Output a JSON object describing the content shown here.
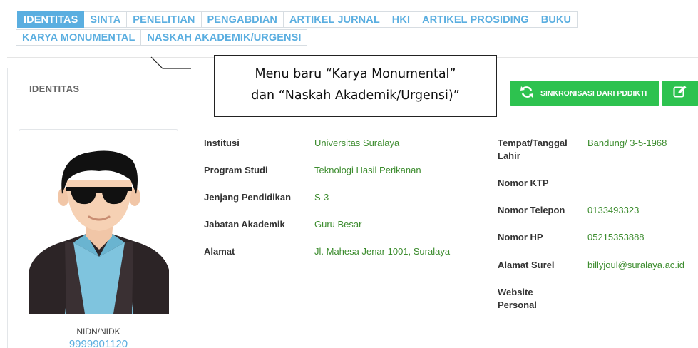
{
  "tabs": {
    "row1": [
      "IDENTITAS",
      "SINTA",
      "PENELITIAN",
      "PENGABDIAN",
      "ARTIKEL JURNAL",
      "HKI",
      "ARTIKEL PROSIDING",
      "BUKU"
    ],
    "row2": [
      "KARYA MONUMENTAL",
      "NASKAH AKADEMIK/URGENSI"
    ],
    "active": "IDENTITAS"
  },
  "panel": {
    "title": "IDENTITAS",
    "sync_label": "SINKRONISASI DARI PDDIKTI"
  },
  "callout": {
    "line1": "Menu baru “Karya Monumental”",
    "line2": "dan “Naskah Akademik/Urgensi)”"
  },
  "profile": {
    "nidn_label": "NIDN/NIDK",
    "nidn_value": "9999901120"
  },
  "left_fields": [
    {
      "label": "Institusi",
      "value": "Universitas Suralaya"
    },
    {
      "label": "Program Studi",
      "value": "Teknologi Hasil Perikanan"
    },
    {
      "label": "Jenjang Pendidikan",
      "value": "S-3"
    },
    {
      "label": "Jabatan Akademik",
      "value": "Guru Besar"
    },
    {
      "label": "Alamat",
      "value": "Jl. Mahesa Jenar 1001, Suralaya"
    }
  ],
  "right_fields": [
    {
      "label": "Tempat/Tanggal Lahir",
      "value": "Bandung/ 3-5-1968"
    },
    {
      "label": "Nomor KTP",
      "value": ""
    },
    {
      "label": "Nomor Telepon",
      "value": "0133493323"
    },
    {
      "label": "Nomor HP",
      "value": "05215353888"
    },
    {
      "label": "Alamat Surel",
      "value": "billyjoul@suralaya.ac.id"
    },
    {
      "label": "Website Personal",
      "value": ""
    }
  ],
  "colors": {
    "accent_blue": "#5aaee0",
    "button_green": "#2dc24f",
    "value_green": "#3c8c2e"
  },
  "icons": {
    "sync": "refresh-icon",
    "edit": "edit-icon"
  }
}
